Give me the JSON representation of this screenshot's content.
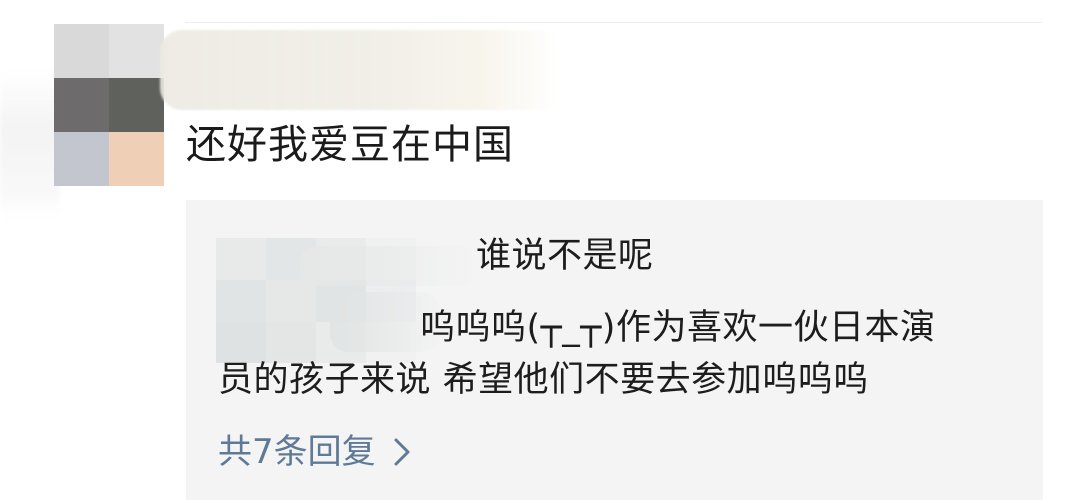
{
  "comment": {
    "text": "还好我爱豆在中国"
  },
  "reply": {
    "line1": "谁说不是呢",
    "line2": "呜呜呜(┬_┬)作为喜欢一伙日本演",
    "line3": "员的孩子来说 希望他们不要去参加呜呜呜"
  },
  "more_replies": {
    "label": "共7条回复",
    "icon": "chevron-right-icon",
    "color": "#5f7a96"
  },
  "colors": {
    "reply_background": "#f4f4f4",
    "text": "#1b1b1b"
  }
}
